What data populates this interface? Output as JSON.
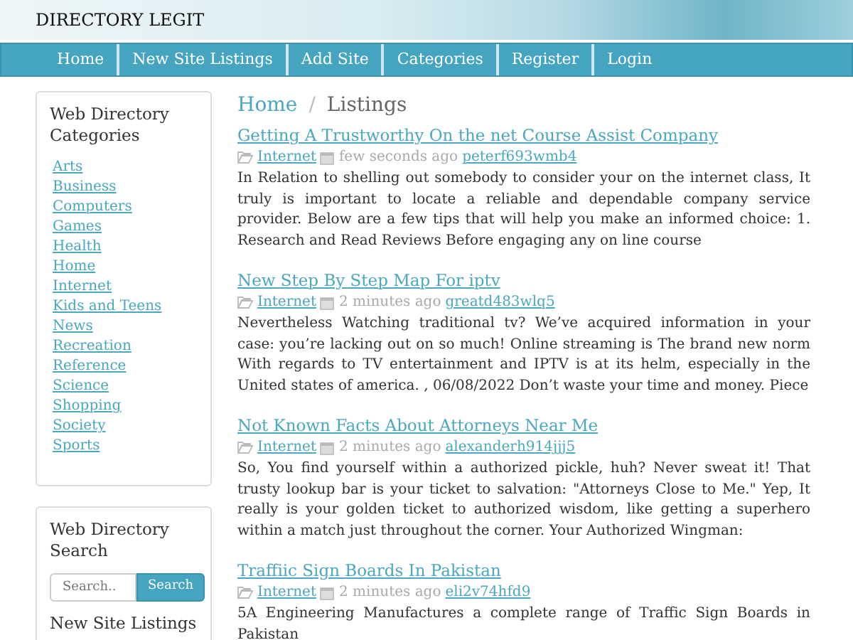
{
  "site_title": "DIRECTORY LEGIT",
  "nav": [
    {
      "label": "Home"
    },
    {
      "label": "New Site Listings"
    },
    {
      "label": "Add Site"
    },
    {
      "label": "Categories"
    },
    {
      "label": "Register"
    },
    {
      "label": "Login"
    }
  ],
  "sidebar": {
    "categories_title": "Web Directory Categories",
    "categories": [
      "Arts",
      "Business",
      "Computers",
      "Games",
      "Health",
      "Home",
      "Internet",
      "Kids and Teens",
      "News",
      "Recreation",
      "Reference",
      "Science",
      "Shopping",
      "Society",
      "Sports"
    ],
    "search_title": "Web Directory Search",
    "search_placeholder": "Search..",
    "search_button": "Search",
    "listings_title": "New Site Listings"
  },
  "breadcrumb": [
    "Home",
    "Listings"
  ],
  "breadcrumb_separator": "/",
  "listings": [
    {
      "title": "Getting A Trustworthy On the net Course Assist Company",
      "category": "Internet",
      "time": "few seconds ago",
      "user": "peterf693wmb4",
      "body": "In Relation to shelling out somebody to consider your on the internet class, It truly is important to locate a reliable and dependable company service provider. Below are a few tips that will help you make an informed choice: 1. Research and Read Reviews Before engaging any on line course"
    },
    {
      "title": "New Step By Step Map For iptv",
      "category": "Internet",
      "time": "2 minutes ago",
      "user": "greatd483wlq5",
      "body": "Nevertheless Watching traditional tv? We’ve acquired information in your case: you’re lacking out on so much! Online streaming is The brand new norm With regards to TV entertainment and IPTV is at its helm, especially in the United states of america. , 06/08/2022 Don’t waste your time and money. Piece"
    },
    {
      "title": "Not Known Facts About Attorneys Near Me",
      "category": "Internet",
      "time": "2 minutes ago",
      "user": "alexanderh914jjj5",
      "body": "So, You find yourself within a authorized pickle, huh? Never sweat it! That trusty lookup bar is your ticket to salvation: \"Attorneys Close to Me.\" Yep, It really is your golden ticket to authorized wisdom, like getting a superhero within a match just throughout the corner. Your Authorized Wingman:"
    },
    {
      "title": "Traffiic Sign Boards In Pakistan",
      "category": "Internet",
      "time": "2 minutes ago",
      "user": "eli2v74hfd9",
      "body": "5A Engineering Manufactures a complete range of Traffic Sign Boards in Pakistan"
    }
  ]
}
